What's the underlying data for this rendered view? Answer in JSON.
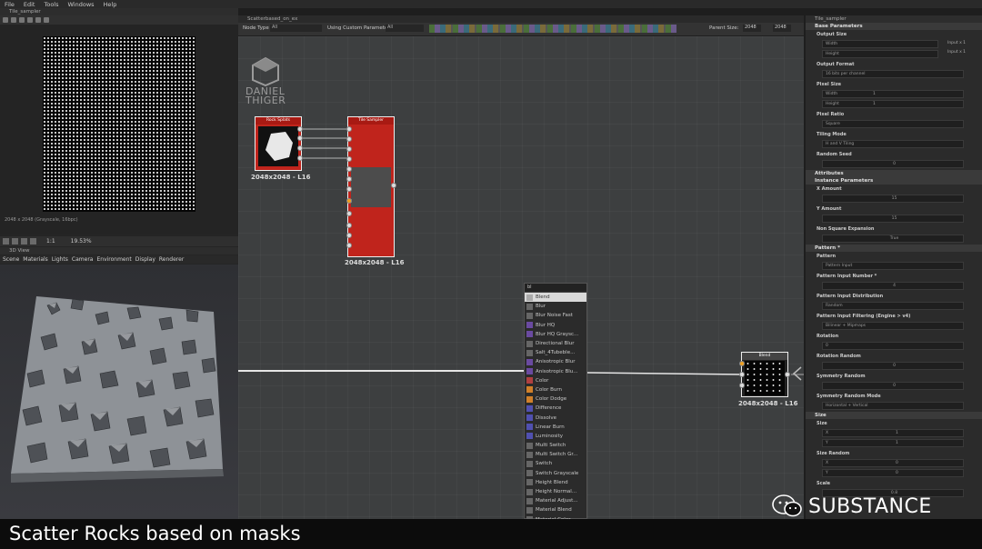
{
  "menu": [
    "File",
    "Edit",
    "Tools",
    "Windows",
    "Help"
  ],
  "viewer2d": {
    "title": "Tile_sampler",
    "info": "2048 x 2048 (Grayscale, 16bpc)",
    "zoom": "19.53%",
    "ratio": "1:1"
  },
  "view3d": {
    "title": "3D View",
    "menu": [
      "Scene",
      "Materials",
      "Lights",
      "Camera",
      "Environment",
      "Display",
      "Renderer"
    ]
  },
  "graph": {
    "title": "Scatterbased_on_ex",
    "node_type_label": "Node Type",
    "node_type_value": "All",
    "custom_params_label": "Using Custom Parameters",
    "custom_params_value": "All",
    "parent_size_label": "Parent Size:",
    "parent_size_value": "2048",
    "size_value": "2048",
    "logo_line1": "DANIEL",
    "logo_line2": "THIGER",
    "nodes": [
      {
        "title": "Rock Splats",
        "label": "2048x2048 - L16"
      },
      {
        "title": "Tile Sampler",
        "label": "2048x2048 - L16"
      },
      {
        "title": "Blend",
        "label": "2048x2048 - L16"
      }
    ]
  },
  "dropdown": {
    "search": "bl",
    "items": [
      "Blend",
      "Blur",
      "Blur Noise Fast",
      "Blur HQ",
      "Blur HQ Graysc...",
      "Directional Blur",
      "Salt_4Tubeble...",
      "Anisotropic Blur",
      "Anisotropic Blu...",
      "Color",
      "Color Burn",
      "Color Dodge",
      "Difference",
      "Dissolve",
      "Linear Burn",
      "Luminosity",
      "Multi Switch",
      "Multi Switch Gr...",
      "Switch",
      "Switch Grayscale",
      "Height Blend",
      "Height Normal...",
      "Material Adjust...",
      "Material Blend",
      "Material Color..."
    ]
  },
  "panel": {
    "title": "Tile_sampler",
    "sections": [
      {
        "name": "Base Parameters",
        "rows": [
          {
            "label": "Output Size",
            "fields": [
              "Width",
              "Height"
            ],
            "side": [
              "Input x 1",
              "Input x 1"
            ]
          },
          {
            "label": "Output Format",
            "fields": [
              "16 bits per channel"
            ]
          },
          {
            "label": "Pixel Size",
            "fields": [
              "Width",
              "Height"
            ],
            "values": [
              "1",
              "1"
            ]
          },
          {
            "label": "Pixel Ratio",
            "fields": [
              "Square"
            ]
          },
          {
            "label": "Tiling Mode",
            "fields": [
              "H and V Tiling"
            ]
          },
          {
            "label": "Random Seed",
            "fields": [
              "0"
            ]
          }
        ]
      },
      {
        "name": "Attributes",
        "rows": []
      },
      {
        "name": "Instance Parameters",
        "rows": [
          {
            "label": "X Amount",
            "fields": [
              "15"
            ]
          },
          {
            "label": "Y Amount",
            "fields": [
              "15"
            ]
          },
          {
            "label": "Non Square Expansion",
            "fields": [
              "True"
            ]
          }
        ]
      },
      {
        "name": "Pattern *",
        "rows": [
          {
            "label": "Pattern",
            "fields": [
              "Pattern Input"
            ]
          },
          {
            "label": "Pattern Input Number *",
            "fields": [
              "4"
            ]
          },
          {
            "label": "Pattern Input Distribution",
            "fields": [
              "Random"
            ]
          },
          {
            "label": "Pattern Input Filtering (Engine > v4)",
            "fields": [
              "Bilinear + Mipmaps"
            ]
          },
          {
            "label": "Rotation",
            "fields": [
              "0"
            ]
          },
          {
            "label": "Rotation Random",
            "fields": [
              "0"
            ]
          },
          {
            "label": "Symmetry Random",
            "fields": [
              "0"
            ]
          },
          {
            "label": "Symmetry Random Mode",
            "fields": [
              "Horizontal + Vertical"
            ]
          }
        ]
      },
      {
        "name": "Size",
        "rows": [
          {
            "label": "Size",
            "fields": [
              "X",
              "Y"
            ],
            "values": [
              "1",
              "1"
            ]
          },
          {
            "label": "Size Random",
            "fields": [
              "X",
              "Y"
            ],
            "values": [
              "0",
              "0"
            ]
          },
          {
            "label": "Scale",
            "fields": [
              "0.8"
            ]
          }
        ]
      }
    ]
  },
  "caption": "Scatter Rocks based on masks",
  "watermark": "SUBSTANCE",
  "colors": {
    "node_red": "#c0241c",
    "graph_bg": "#3d3f40",
    "panel_bg": "#2b2b2b"
  }
}
